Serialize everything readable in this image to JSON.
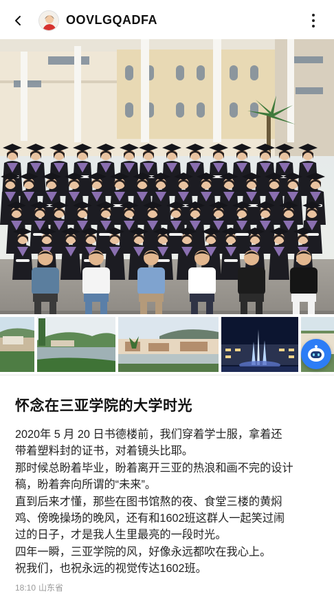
{
  "header": {
    "username": "OOVLGQADFA"
  },
  "icons": {
    "back": "chevron-left-icon",
    "more": "more-vertical-icon",
    "assistant": "robot-assistant-icon"
  },
  "post": {
    "title": "怀念在三亚学院的大学时光",
    "lines": [
      "2020年 5 月 20 日书德楼前，我们穿着学士服，拿着还",
      "带着塑料封的证书，对着镜头比耶。",
      "那时候总盼着毕业，盼着离开三亚的热浪和画不完的设计",
      "稿，盼着奔向所谓的“未来”。",
      "直到后来才懂，那些在图书馆熬的夜、食堂三楼的黄焖",
      "鸡、傍晚操场的晚风，还有和1602班这群人一起笑过闹",
      "过的日子，才是我人生里最亮的一段时光。",
      "四年一瞬，三亚学院的风，好像永远都吹在我心上。",
      "祝我们，也祝永远的视觉传达1602班。"
    ],
    "time": "18:10",
    "location": "山东省"
  },
  "colors": {
    "accent": "#2d7df6",
    "meta_text": "#999999"
  }
}
